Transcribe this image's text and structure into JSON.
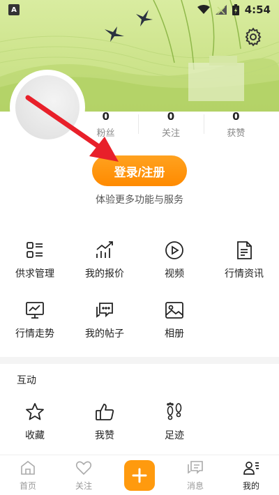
{
  "status_bar": {
    "app_badge": "A",
    "time": "4:54"
  },
  "profile": {
    "stats": [
      {
        "value": "0",
        "label": "粉丝"
      },
      {
        "value": "0",
        "label": "关注"
      },
      {
        "value": "0",
        "label": "获赞"
      }
    ],
    "login_label": "登录/注册",
    "login_subtitle": "体验更多功能与服务"
  },
  "tools": [
    {
      "label": "供求管理",
      "icon": "list-grid-icon"
    },
    {
      "label": "我的报价",
      "icon": "chart-trend-icon"
    },
    {
      "label": "视频",
      "icon": "play-circle-icon"
    },
    {
      "label": "行情资讯",
      "icon": "document-icon"
    },
    {
      "label": "行情走势",
      "icon": "monitor-chart-icon"
    },
    {
      "label": "我的帖子",
      "icon": "chat-bubbles-icon"
    },
    {
      "label": "相册",
      "icon": "image-icon"
    }
  ],
  "interaction": {
    "title": "互动",
    "items": [
      {
        "label": "收藏",
        "icon": "star-icon"
      },
      {
        "label": "我赞",
        "icon": "thumbs-up-icon"
      },
      {
        "label": "足迹",
        "icon": "footprints-icon"
      }
    ]
  },
  "tabbar": {
    "items": [
      {
        "label": "首页",
        "icon": "home-icon"
      },
      {
        "label": "关注",
        "icon": "heart-icon"
      },
      {
        "label": "",
        "icon": "plus-icon"
      },
      {
        "label": "消息",
        "icon": "message-icon"
      },
      {
        "label": "我的",
        "icon": "profile-icon"
      }
    ],
    "active": "我的"
  },
  "colors": {
    "accent": "#ff8a00",
    "arrow": "#e8202a",
    "banner": "#cfe58f"
  }
}
